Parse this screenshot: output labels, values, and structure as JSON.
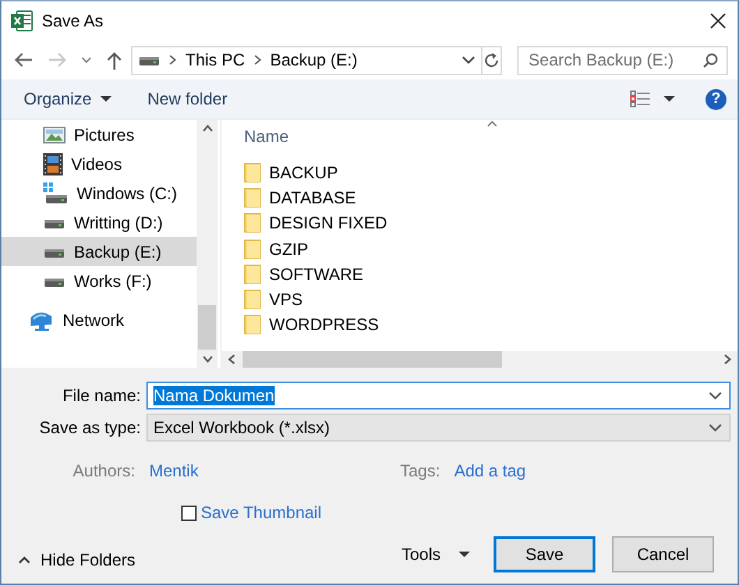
{
  "window": {
    "title": "Save As"
  },
  "address": {
    "crumbs": [
      "This PC",
      "Backup (E:)"
    ]
  },
  "search": {
    "placeholder": "Search Backup (E:)"
  },
  "toolbar": {
    "organize": "Organize",
    "new_folder": "New folder",
    "help": "?"
  },
  "sidebar": {
    "items": [
      {
        "label": "Pictures",
        "kind": "pictures",
        "selected": false
      },
      {
        "label": "Videos",
        "kind": "videos",
        "selected": false
      },
      {
        "label": "Windows (C:)",
        "kind": "system-drive",
        "selected": false
      },
      {
        "label": "Writting (D:)",
        "kind": "drive",
        "selected": false
      },
      {
        "label": "Backup (E:)",
        "kind": "drive",
        "selected": true
      },
      {
        "label": "Works (F:)",
        "kind": "drive",
        "selected": false
      },
      {
        "label": "Network",
        "kind": "network",
        "selected": false
      }
    ]
  },
  "file_list": {
    "columns": [
      "Name"
    ],
    "rows": [
      {
        "name": "BACKUP"
      },
      {
        "name": "DATABASE"
      },
      {
        "name": "DESIGN FIXED"
      },
      {
        "name": "GZIP"
      },
      {
        "name": "SOFTWARE"
      },
      {
        "name": "VPS"
      },
      {
        "name": "WORDPRESS"
      }
    ]
  },
  "form": {
    "file_name": {
      "label": "File name:",
      "value": "Nama Dokumen"
    },
    "save_as_type": {
      "label": "Save as type:",
      "value": "Excel Workbook (*.xlsx)"
    },
    "authors": {
      "label": "Authors:",
      "value": "Mentik"
    },
    "tags": {
      "label": "Tags:",
      "value": "Add a tag"
    },
    "save_thumbnail": {
      "label": "Save Thumbnail",
      "checked": false
    }
  },
  "footer": {
    "hide_folders": "Hide Folders",
    "tools": "Tools",
    "buttons": [
      "Save",
      "Cancel"
    ]
  }
}
